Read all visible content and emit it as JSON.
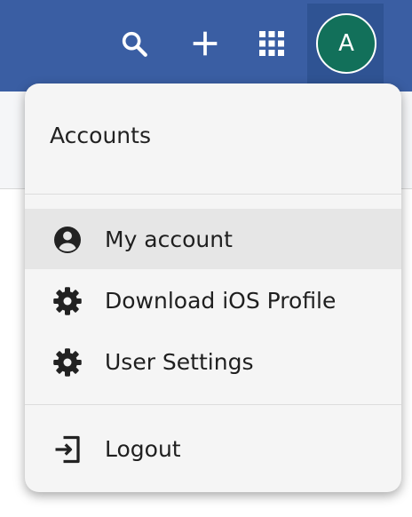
{
  "topbar": {
    "icons": [
      "search-icon",
      "plus-icon",
      "apps-grid-icon"
    ],
    "avatar_initial": "A",
    "colors": {
      "bar": "#3a5ea3",
      "avatar": "#12705a"
    }
  },
  "menu": {
    "header": "Accounts",
    "items": [
      {
        "label": "My account",
        "icon": "account-circle-icon",
        "active": true
      },
      {
        "label": "Download iOS Profile",
        "icon": "gear-icon"
      },
      {
        "label": "User Settings",
        "icon": "gear-icon"
      },
      {
        "label": "Logout",
        "icon": "logout-icon"
      }
    ]
  }
}
